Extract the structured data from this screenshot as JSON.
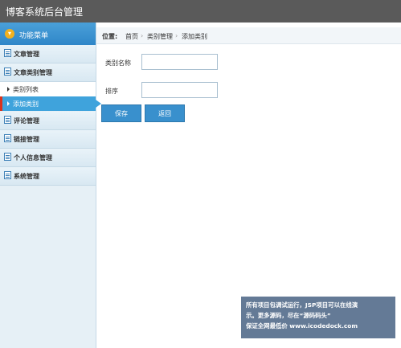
{
  "header": {
    "title": "博客系统后台管理"
  },
  "sidebar": {
    "menu_title": "功能菜单",
    "items": [
      {
        "label": "文章管理"
      },
      {
        "label": "文章类别管理"
      },
      {
        "label": "评论管理"
      },
      {
        "label": "链接管理"
      },
      {
        "label": "个人信息管理"
      },
      {
        "label": "系统管理"
      }
    ],
    "subitems": [
      {
        "label": "类别列表"
      },
      {
        "label": "添加类别"
      }
    ]
  },
  "breadcrumb": {
    "prefix": "位置:",
    "home": "首页",
    "level1": "类别管理",
    "level2": "添加类别"
  },
  "form": {
    "category_name_label": "类别名称",
    "category_name_value": "",
    "order_label": "排序",
    "order_value": "",
    "save_label": "保存",
    "back_label": "返回"
  },
  "watermark": {
    "line1": "所有项目包调试运行，JSP项目可以在线演",
    "line2": "示。更多源码，尽在“源码码头”",
    "line3": "保证全网最低价 www.icodedock.com"
  }
}
